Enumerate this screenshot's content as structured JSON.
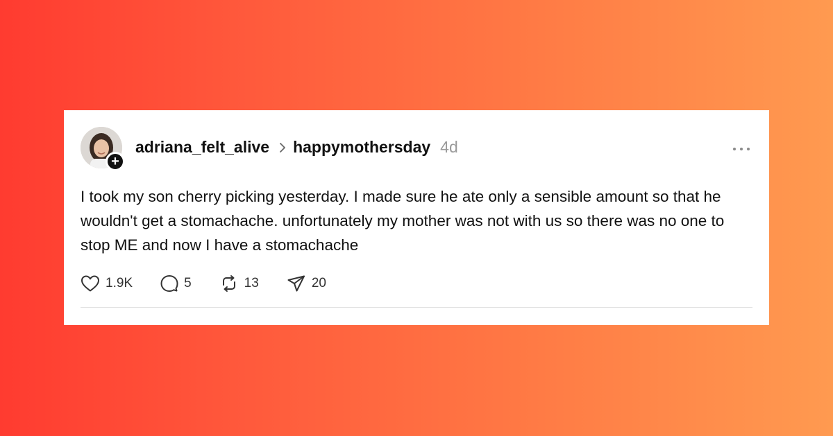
{
  "post": {
    "author": "adriana_felt_alive",
    "community": "happymothersday",
    "timestamp": "4d",
    "follow_icon": "plus-icon",
    "text": "I took my son cherry picking yesterday. I made sure he ate only a sensible amount so that he wouldn't get a stomachache. unfortunately my mother was not with us so there was no one to stop ME and now I have a stomachache",
    "stats": {
      "likes": "1.9K",
      "replies": "5",
      "reposts": "13",
      "shares": "20"
    }
  },
  "colors": {
    "background_start": "#ff3b30",
    "background_end": "#ff9a50",
    "card": "#ffffff",
    "text": "#111111",
    "muted": "#9a9a9a"
  }
}
